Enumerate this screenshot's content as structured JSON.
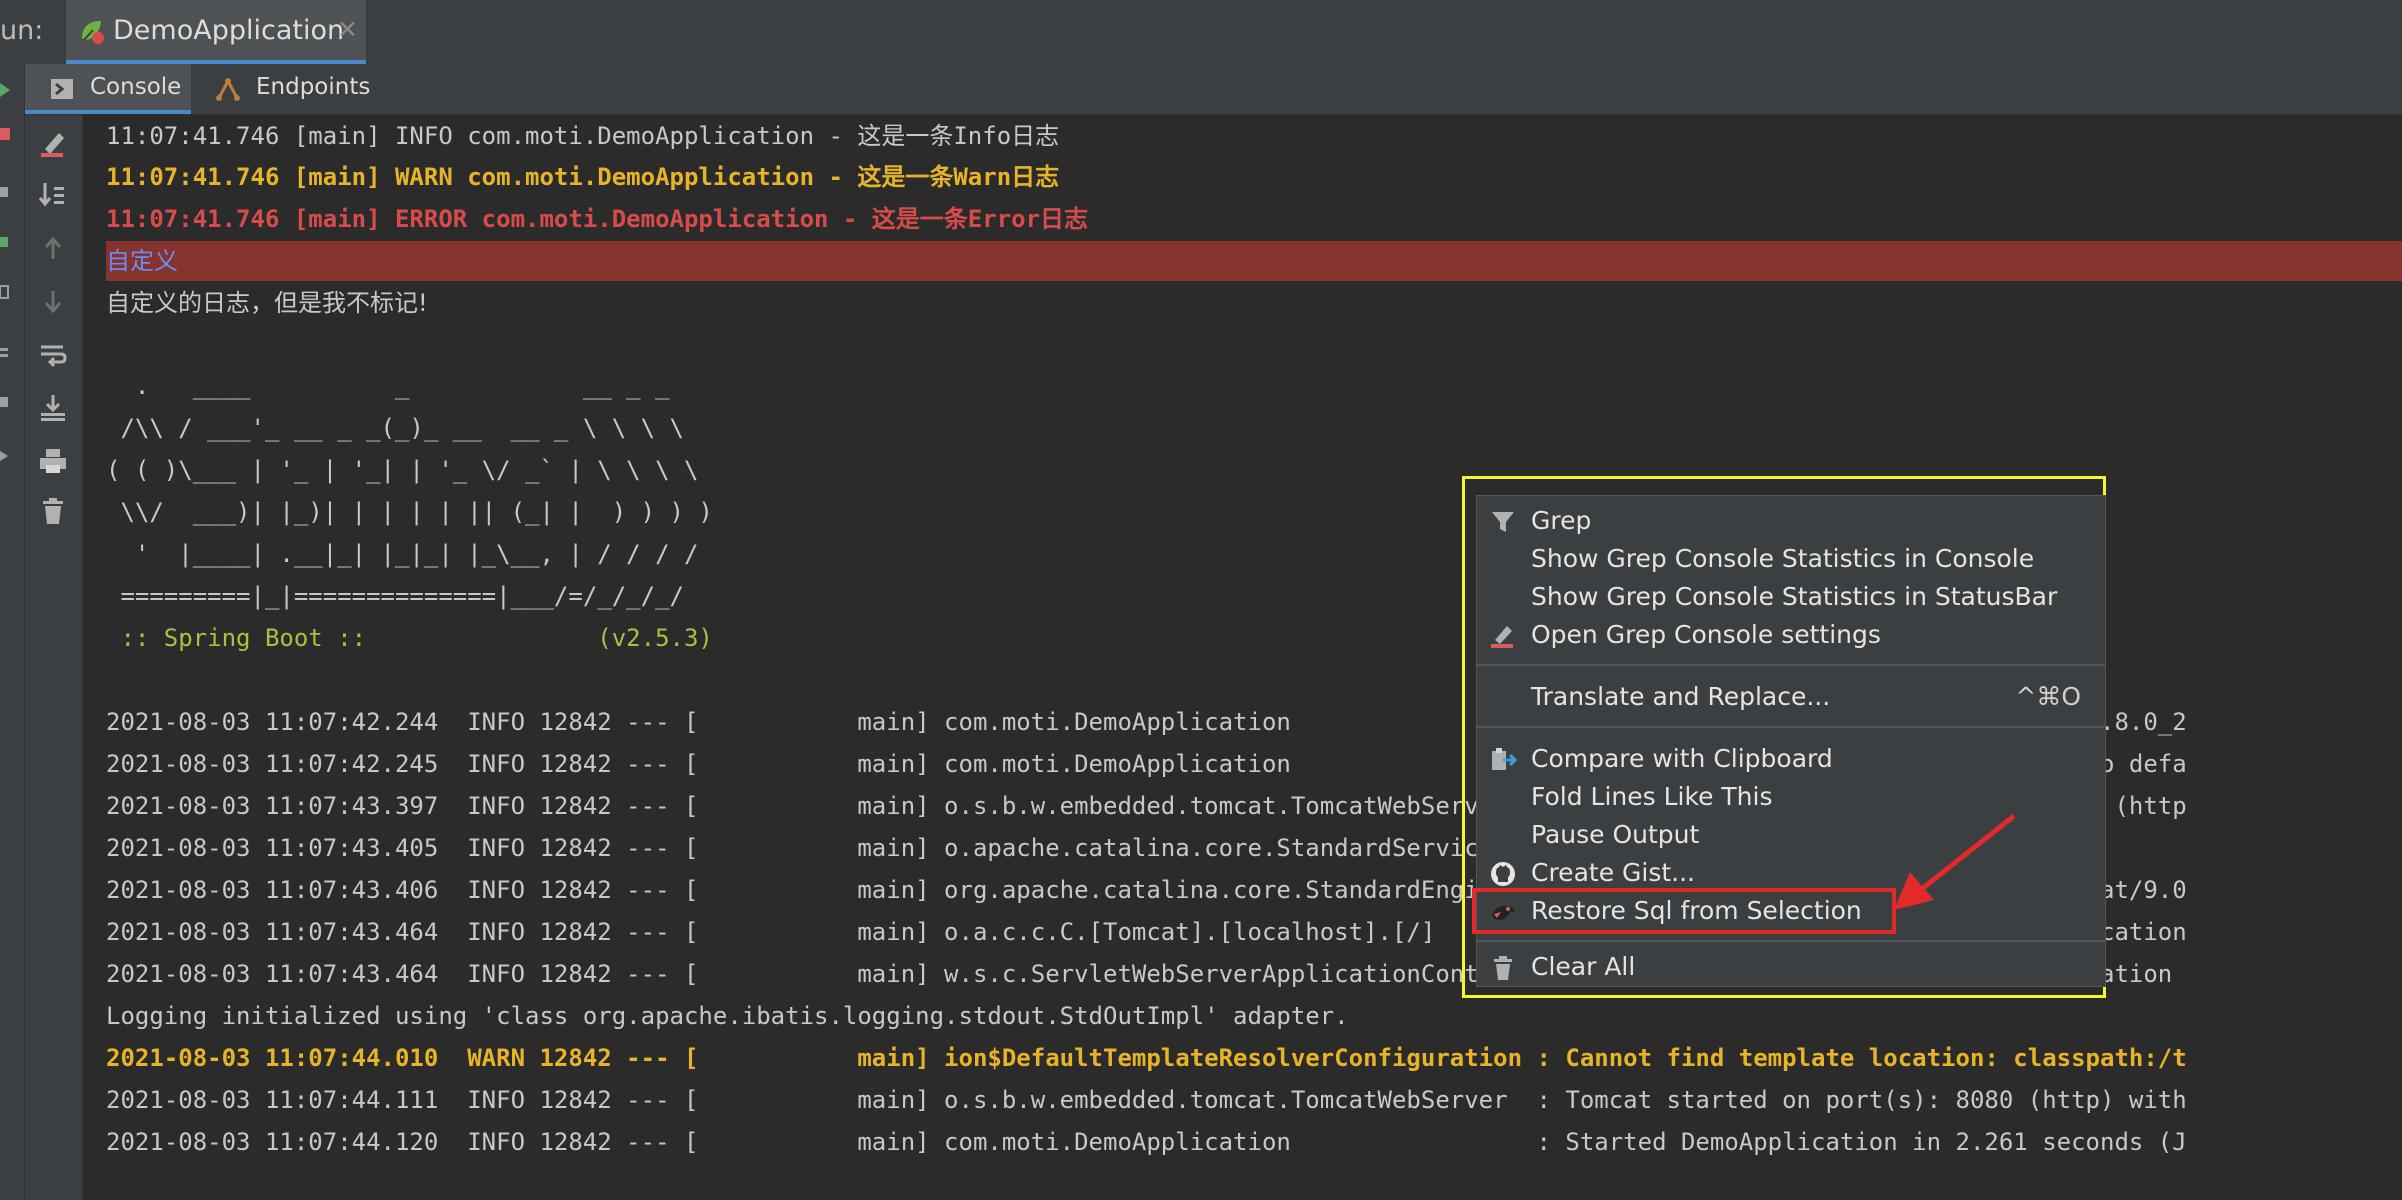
{
  "run_bar": {
    "label": "un:",
    "tab_title": "DemoApplication",
    "close_glyph": "✕",
    "tab_icon": "spring-leaf-icon"
  },
  "sub_tabs": [
    {
      "label": "Console",
      "icon": "console-icon"
    },
    {
      "label": "Endpoints",
      "icon": "endpoints-icon"
    }
  ],
  "toolbar_icons": [
    "clear-all-icon",
    "scroll-to-end-icon",
    "up-arrow-icon",
    "down-arrow-icon",
    "soft-wrap-icon",
    "scroll-to-bottom-icon",
    "print-icon",
    "trash-icon"
  ],
  "console": {
    "log1": "11:07:41.746 [main] INFO com.moti.DemoApplication - 这是一条Info日志",
    "log2": "11:07:41.746 [main] WARN com.moti.DemoApplication - 这是一条Warn日志",
    "log3": "11:07:41.746 [main] ERROR com.moti.DemoApplication - 这是一条Error日志",
    "custom": "自定义",
    "custom_plain": "自定义的日志，但是我不标记!",
    "banner": [
      "  .   ____          _            __ _ _",
      " /\\\\ / ___'_ __ _ _(_)_ __  __ _ \\ \\ \\ \\",
      "( ( )\\___ | '_ | '_| | '_ \\/ _` | \\ \\ \\ \\",
      " \\\\/  ___)| |_)| | | | | || (_| |  ) ) ) )",
      "  '  |____| .__|_| |_|_| |_\\__, | / / / /",
      " =========|_|==============|___/=/_/_/_/",
      " :: Spring Boot ::                (v2.5.3)"
    ],
    "entries": [
      "2021-08-03 11:07:42.244  INFO 12842 --- [           main] com.moti.DemoApplication                 : Starting DemoApplication using Java 1.8.0_2",
      "2021-08-03 11:07:42.245  INFO 12842 --- [           main] com.moti.DemoApplication                 : No active profile set, falling back to defa",
      "2021-08-03 11:07:43.397  INFO 12842 --- [           main] o.s.b.w.embedded.tomcat.TomcatWebServer  : Tomcat initialized with port(s): 8080 (http",
      "2021-08-03 11:07:43.405  INFO 12842 --- [           main] o.apache.catalina.core.StandardService   : Starting service [Tomcat]",
      "2021-08-03 11:07:43.406  INFO 12842 --- [           main] org.apache.catalina.core.StandardEngine  : Starting Servlet engine: [Apache Tomcat/9.0",
      "2021-08-03 11:07:43.464  INFO 12842 --- [           main] o.a.c.c.C.[Tomcat].[localhost].[/]       : Initializing Spring embedded WebApplication",
      "2021-08-03 11:07:43.464  INFO 12842 --- [           main] w.s.c.ServletWebServerApplicationContext : Root WebApplicationContext: initialization "
    ],
    "mybatis": "Logging initialized using 'class org.apache.ibatis.logging.stdout.StdOutImpl' adapter.",
    "warn_entry": "2021-08-03 11:07:44.010  WARN 12842 --- [           main] ion$DefaultTemplateResolverConfiguration : Cannot find template location: classpath:/t",
    "final_entries": [
      "2021-08-03 11:07:44.111  INFO 12842 --- [           main] o.s.b.w.embedded.tomcat.TomcatWebServer  : Tomcat started on port(s): 8080 (http) with",
      "2021-08-03 11:07:44.120  INFO 12842 --- [           main] com.moti.DemoApplication                 : Started DemoApplication in 2.261 seconds (J"
    ]
  },
  "context_menu": {
    "items": [
      {
        "label": "Grep",
        "icon": "filter-icon"
      },
      {
        "label": "Show Grep Console Statistics in Console",
        "icon": ""
      },
      {
        "label": "Show Grep Console Statistics in StatusBar",
        "icon": ""
      },
      {
        "label": "Open Grep Console settings",
        "icon": "highlighter-icon"
      },
      {
        "label": "Translate and Replace...",
        "icon": "",
        "shortcut": "^⌘O"
      },
      {
        "label": "Compare with Clipboard",
        "icon": "compare-clipboard-icon"
      },
      {
        "label": "Fold Lines Like This",
        "icon": ""
      },
      {
        "label": "Pause Output",
        "icon": ""
      },
      {
        "label": "Create Gist...",
        "icon": "github-icon"
      },
      {
        "label": "Restore Sql from Selection",
        "icon": "mybatis-bird-icon"
      },
      {
        "label": "Clear All",
        "icon": "trash-icon"
      }
    ]
  },
  "colors": {
    "background": "#2b2b2b",
    "warn": "#e7b427",
    "error": "#d94b4b",
    "custom_highlight": "#86322d",
    "focus_box": "#f6f62a",
    "annotation_red": "#e22a2a"
  }
}
